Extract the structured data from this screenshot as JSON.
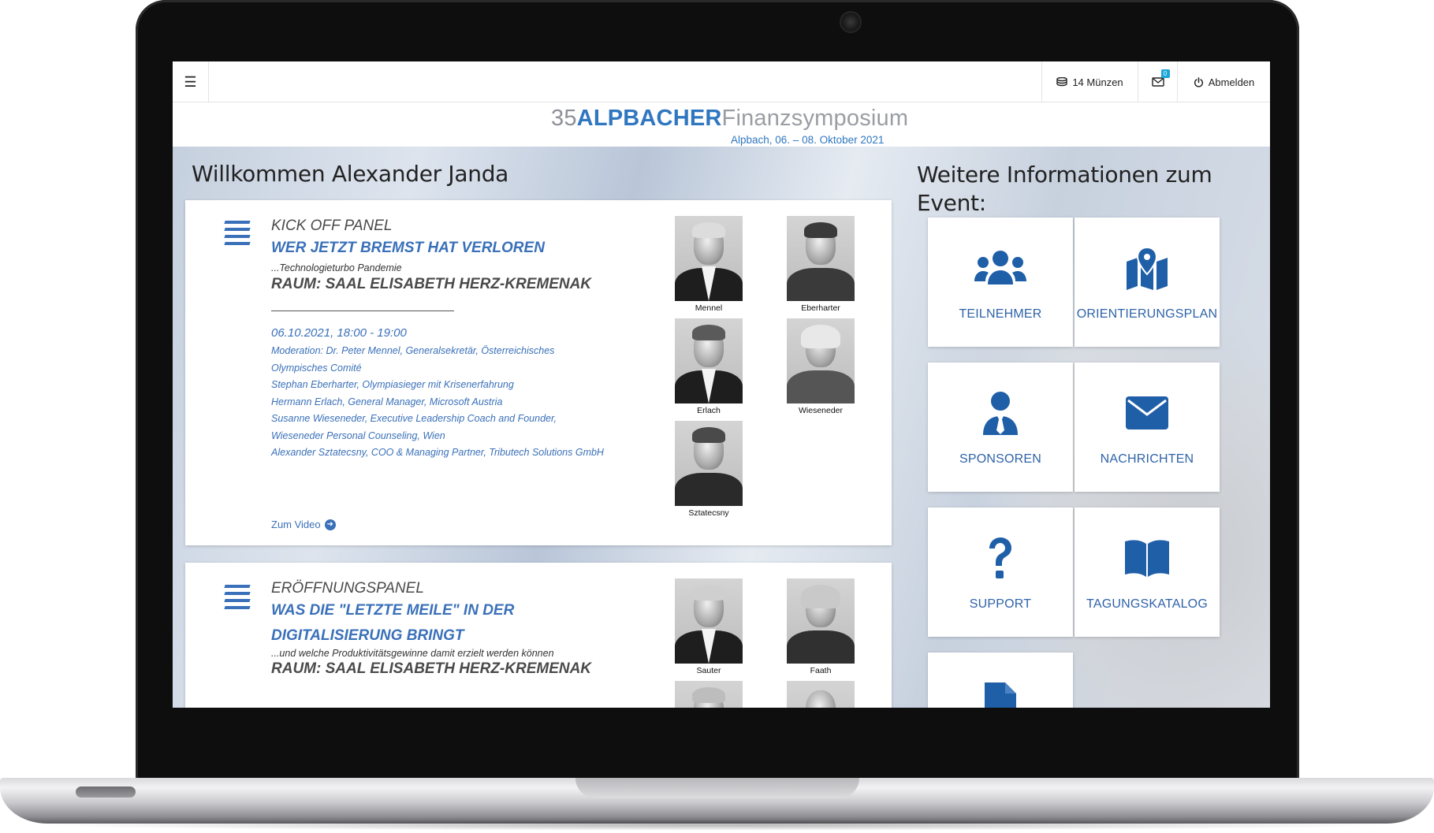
{
  "topbar": {
    "menu_icon": "hamburger-icon",
    "coins_label": "14 Münzen",
    "mail_badge": "0",
    "logout_label": "Abmelden"
  },
  "logo": {
    "number": "35",
    "brand": "ALPBACHER",
    "suffix": "Finanzsymposium",
    "dateline": "Alpbach, 06. – 08. Oktober 2021"
  },
  "main": {
    "welcome": "Willkommen Alexander Janda",
    "info_heading": "Weitere Informationen zum Event:"
  },
  "sessions": [
    {
      "category": "KICK OFF PANEL",
      "title": "WER JETZT BREMST HAT VERLOREN",
      "subtitle": "...Technologieturbo Pandemie",
      "room": "RAUM: SAAL ELISABETH HERZ-KREMENAK",
      "time": "06.10.2021, 18:00 - 19:00",
      "moderation": [
        "Moderation: Dr. Peter Mennel, Generalsekretär, Österreichisches",
        "Olympisches Comité",
        "Stephan Eberharter, Olympiasieger mit Krisenerfahrung",
        "Hermann Erlach, General Manager, Microsoft Austria",
        "Susanne Wieseneder, Executive Leadership Coach and Founder,",
        "Wieseneder Personal Counseling, Wien",
        "Alexander Sztatecsny, COO & Managing Partner, Tributech Solutions GmbH"
      ],
      "link": "Zum Video",
      "speakers": [
        "Mennel",
        "Eberharter",
        "Erlach",
        "Wieseneder",
        "Sztatecsny"
      ]
    },
    {
      "category": "ERÖFFNUNGSPANEL",
      "title": "WAS DIE \"LETZTE MEILE\" IN DER DIGITALISIERUNG BRINGT",
      "subtitle": "...und welche Produktivitätsgewinne damit erzielt werden können",
      "room": "RAUM: SAAL ELISABETH HERZ-KREMENAK",
      "speakers": [
        "Sauter",
        "Faath"
      ]
    }
  ],
  "tiles": [
    {
      "label": "TEILNEHMER",
      "icon": "users-icon"
    },
    {
      "label": "ORIENTIERUNGSPLAN",
      "icon": "map-marker-icon"
    },
    {
      "label": "SPONSOREN",
      "icon": "user-tie-icon"
    },
    {
      "label": "NACHRICHTEN",
      "icon": "envelope-icon"
    },
    {
      "label": "SUPPORT",
      "icon": "question-icon"
    },
    {
      "label": "TAGUNGSKATALOG",
      "icon": "book-icon"
    },
    {
      "label": "",
      "icon": "document-icon"
    }
  ],
  "colors": {
    "brand_blue": "#2f77c0",
    "accent_blue": "#3a70b9",
    "tile_icon_blue": "#1f5fa8"
  }
}
